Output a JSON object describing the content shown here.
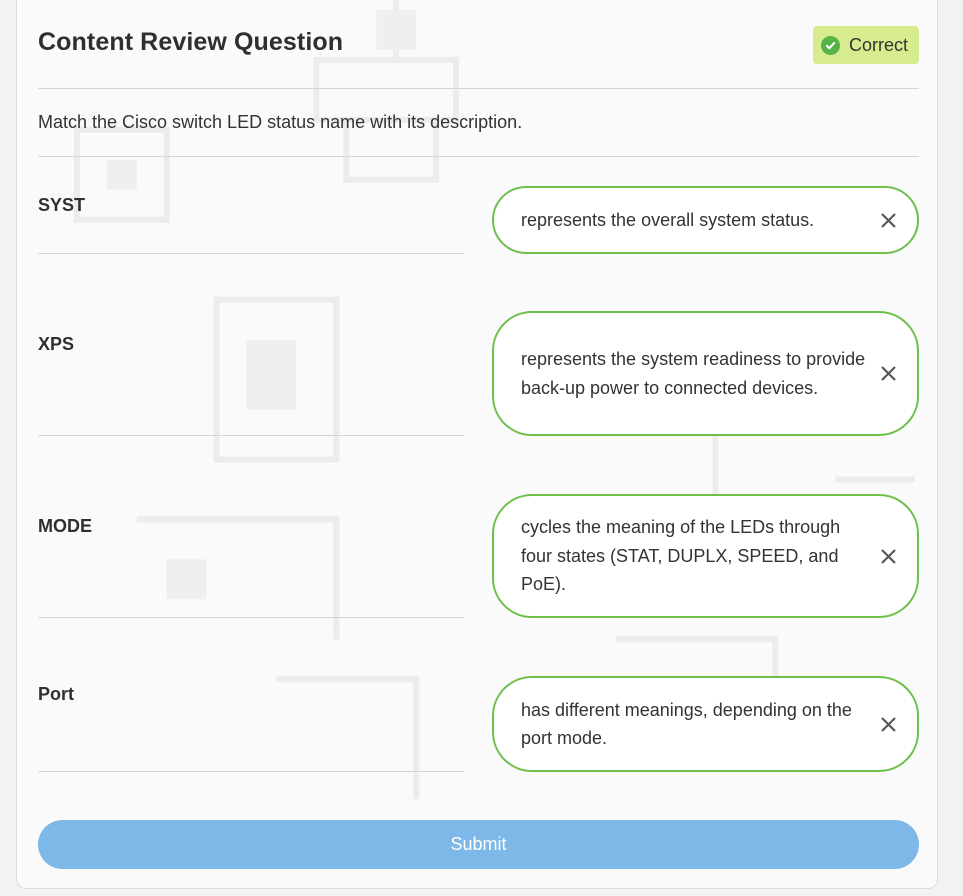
{
  "header": {
    "title": "Content Review Question",
    "status_label": "Correct"
  },
  "question": {
    "prompt": "Match the Cisco switch LED status name with its description."
  },
  "matches": [
    {
      "label": "SYST",
      "answer": "represents the overall system status."
    },
    {
      "label": "XPS",
      "answer": "represents the system readiness to provide back-up power to connected devices."
    },
    {
      "label": "MODE",
      "answer": "cycles the meaning of the LEDs through four states (STAT, DUPLX, SPEED, and PoE)."
    },
    {
      "label": "Port",
      "answer": "has different meanings, depending on the port mode."
    }
  ],
  "footer": {
    "submit_label": "Submit"
  },
  "colors": {
    "correct_badge_bg": "#d7ec8e",
    "correct_icon": "#57b247",
    "answer_border": "#6cc04a",
    "submit_bg": "#7db8e8"
  },
  "icons": {
    "status": "check-circle-icon",
    "remove": "close-icon"
  }
}
